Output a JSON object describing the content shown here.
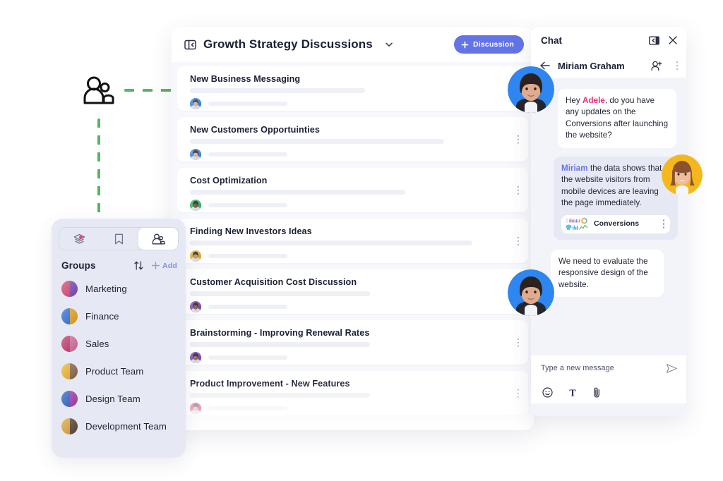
{
  "decor": {
    "people_icon": "people-group-icon",
    "line_color": "#55b661"
  },
  "sidebar": {
    "tabs": [
      {
        "name": "layers-icon",
        "label": "Layers",
        "active": false,
        "badge": true
      },
      {
        "name": "bookmark-icon",
        "label": "Bookmarks",
        "active": false,
        "badge": false
      },
      {
        "name": "people-icon",
        "label": "Groups",
        "active": true,
        "badge": false
      }
    ],
    "title": "Groups",
    "sort_icon": "sort-arrows-icon",
    "add_icon": "plus-icon",
    "add_label": "Add",
    "items": [
      {
        "label": "Marketing",
        "c1": "#d8456f",
        "c2": "#7b4bb5"
      },
      {
        "label": "Finance",
        "c1": "#2e6fd6",
        "c2": "#e9a324"
      },
      {
        "label": "Sales",
        "c1": "#c2386b",
        "c2": "#d86fa0"
      },
      {
        "label": "Product Team",
        "c1": "#f0b429",
        "c2": "#8a6a4a"
      },
      {
        "label": "Design Team",
        "c1": "#2a63c8",
        "c2": "#a23fb0"
      },
      {
        "label": "Development Team",
        "c1": "#e0a33a",
        "c2": "#5a4636"
      }
    ]
  },
  "main": {
    "board_icon": "board-panel-icon",
    "title": "Growth Strategy Discussions",
    "chevron_icon": "chevron-down-icon",
    "new_button": {
      "icon": "plus-icon",
      "label": "Discussion",
      "color": "#6373e8"
    },
    "kebab_icon": "kebab-menu-icon",
    "cards": [
      {
        "title": "New Business Messaging",
        "bar1": 248,
        "bar2": 112,
        "ring": "#2e86f0",
        "skin": "#e8b9a0",
        "hair": "#3a2a22"
      },
      {
        "title": "New Customers Opportuinties",
        "bar1": 360,
        "bar2": 112,
        "ring": "#2e86f0",
        "skin": "#e8b9a0",
        "hair": "#2e1f18"
      },
      {
        "title": "Cost Optimization",
        "bar1": 305,
        "bar2": 112,
        "ring": "#32b46b",
        "skin": "#7a4a33",
        "hair": "#1c1410"
      },
      {
        "title": "Finding New Investors Ideas",
        "bar1": 400,
        "bar2": 112,
        "ring": "#f0b429",
        "skin": "#d79a72",
        "hair": "#241a12"
      },
      {
        "title": "Customer Acquisition Cost Discussion",
        "bar1": 255,
        "bar2": 112,
        "ring": "#7b42c4",
        "skin": "#8a5638",
        "hair": "#1a120c"
      },
      {
        "title": "Brainstorming - Improving Renewal Rates",
        "bar1": 255,
        "bar2": 112,
        "ring": "#7b42c4",
        "skin": "#9b6442",
        "hair": "#1a120c"
      },
      {
        "title": "Product Improvement - New Features",
        "bar1": 255,
        "bar2": 112,
        "ring": "#e3136f",
        "skin": "#e3b49a",
        "hair": "#3a221a"
      }
    ]
  },
  "chat": {
    "panel_label": "Chat",
    "collapse_icon": "collapse-panel-icon",
    "close_icon": "close-icon",
    "back_icon": "back-arrow-icon",
    "contact_name": "Miriam Graham",
    "add_person_icon": "add-person-icon",
    "more_icon": "kebab-menu-icon",
    "messages": [
      {
        "id": "msg-1",
        "direction": "incoming",
        "mention": "Adele",
        "mention_color": "#ef2d7a",
        "prefix": "Hey ",
        "text": ", do you have any updates on the Conversions after launching the website?"
      },
      {
        "id": "msg-2",
        "direction": "outgoing",
        "mention": "Miriam",
        "mention_color": "#6373e8",
        "prefix": "",
        "text": " the data shows that the website visitors from mobile devices are leaving the page immediately.",
        "attachment": {
          "name": "Conversions",
          "thumb": "dashboard-thumbnail",
          "menu_icon": "kebab-menu-icon"
        }
      },
      {
        "id": "msg-3",
        "direction": "incoming",
        "mention": "",
        "prefix": "",
        "text": "We need to evaluate the responsive design of the website."
      }
    ],
    "composer": {
      "placeholder": "Type a new message",
      "send_icon": "send-icon",
      "tools": [
        {
          "name": "emoji-icon",
          "glyph": "☺"
        },
        {
          "name": "text-format-icon",
          "glyph": "T"
        },
        {
          "name": "attachment-icon",
          "glyph": "paperclip"
        }
      ]
    }
  }
}
